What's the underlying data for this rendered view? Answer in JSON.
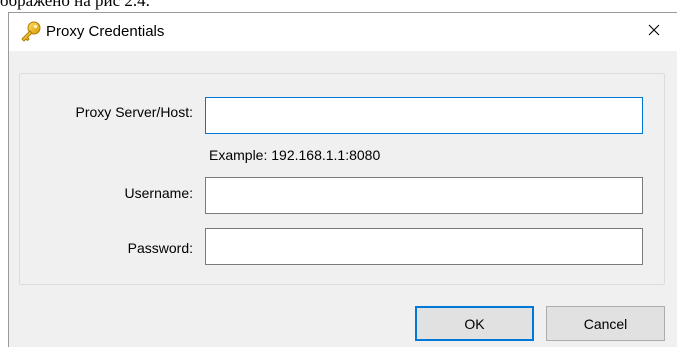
{
  "page": {
    "caption": "ображено на рис 2.4."
  },
  "window": {
    "title": "Proxy Credentials",
    "icon": "key-icon",
    "close_glyph": "✕"
  },
  "form": {
    "host": {
      "label": "Proxy Server/Host:",
      "value": "",
      "hint": "Example: 192.168.1.1:8080"
    },
    "username": {
      "label": "Username:",
      "value": ""
    },
    "password": {
      "label": "Password:",
      "value": ""
    }
  },
  "buttons": {
    "ok": "OK",
    "cancel": "Cancel"
  },
  "colors": {
    "focus": "#0078d7",
    "key_gold": "#f2b705"
  }
}
